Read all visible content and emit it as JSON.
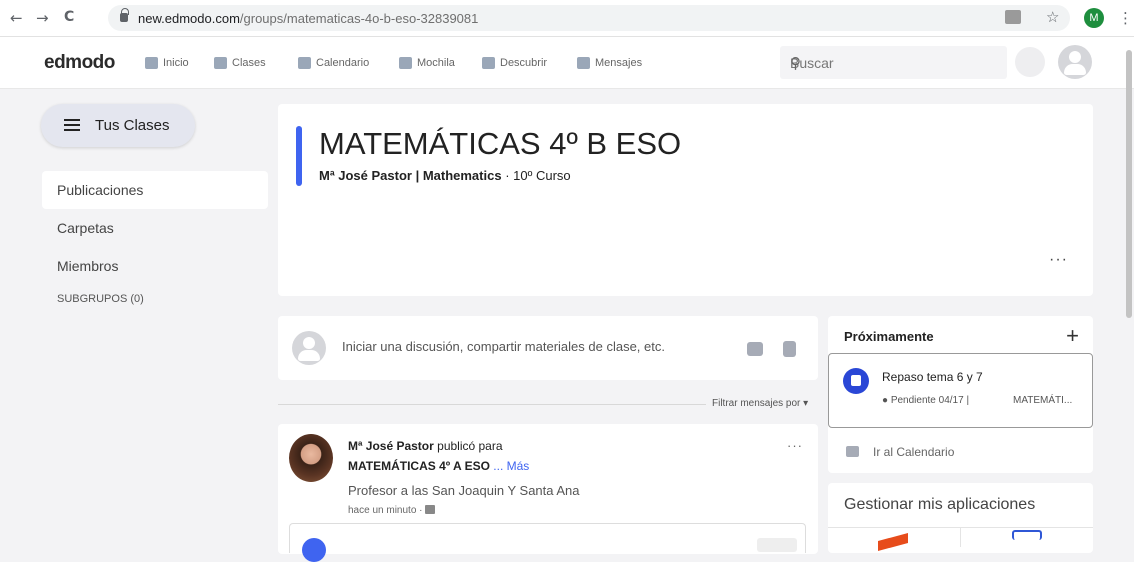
{
  "browser": {
    "url_domain": "new.edmodo.com",
    "url_path": "/groups/matematicas-4o-b-eso-32839081",
    "profile_initial": "M",
    "back": "←",
    "forward": "→",
    "reload": "C",
    "star": "☆",
    "menu": "⋮"
  },
  "topbar": {
    "logo": "edmodo",
    "nav": [
      "Inicio",
      "Clases",
      "Calendario",
      "Mochila",
      "Descubrir",
      "Mensajes"
    ],
    "search_placeholder": "Buscar"
  },
  "sidebar": {
    "tus_clases": "Tus Clases",
    "links": [
      "Publicaciones",
      "Carpetas",
      "Miembros"
    ],
    "subgrupos": "SUBGRUPOS (0)"
  },
  "header": {
    "title": "MATEMÁTICAS 4º B ESO",
    "teacher": "Mª José Pastor | Mathematics",
    "course": "· 10º Curso",
    "dots": "···"
  },
  "composer": {
    "placeholder": "Iniciar una discusión, compartir materiales de clase, etc."
  },
  "filter": "Filtrar mensajes por ▾",
  "post": {
    "author": "Mª José Pastor",
    "action": " publicó para",
    "target": "MATEMÁTICAS 4º A ESO",
    "more": " ... Más",
    "body": "Profesor a las San Joaquin Y Santa Ana",
    "time": "hace un minuto  ·",
    "dots": "···"
  },
  "upcoming": {
    "title": "Próximamente",
    "plus": "+",
    "event_title": "Repaso tema 6 y 7",
    "event_due": "● Pendiente 04/17  |",
    "event_class": "MATEMÁTI...",
    "calendar_link": "Ir al Calendario"
  },
  "apps": {
    "title": "Gestionar mis aplicaciones"
  }
}
